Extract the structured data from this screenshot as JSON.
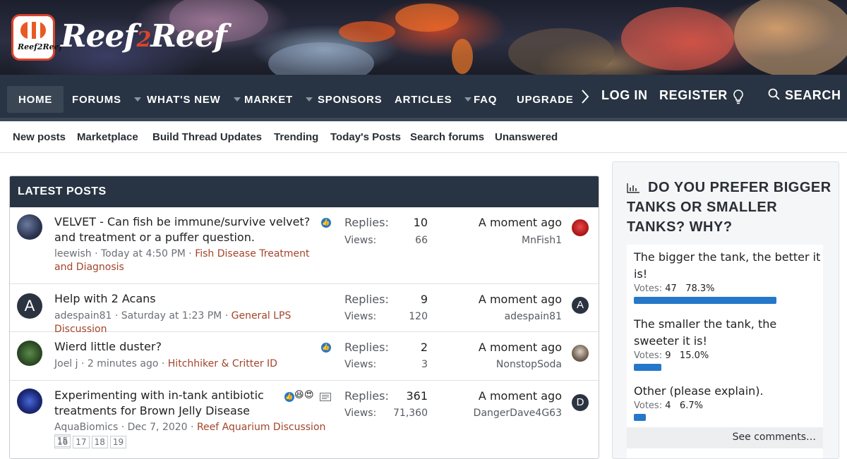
{
  "logo": {
    "badge_text": "Reef2Reef",
    "text_left": "Reef",
    "text_mid": "2",
    "text_right": "Reef"
  },
  "nav": {
    "items": [
      {
        "label": "HOME",
        "active": true
      },
      {
        "label": "FORUMS",
        "caret": true
      },
      {
        "label": "WHAT'S NEW",
        "caret": true
      },
      {
        "label": "MARKET",
        "caret": true
      },
      {
        "label": "SPONSORS"
      },
      {
        "label": "ARTICLES",
        "caret": true
      },
      {
        "label": "FAQ"
      },
      {
        "label": "UPGRADE"
      }
    ],
    "more_icon": "chevron-right-icon",
    "login": "LOG IN",
    "register": "REGISTER",
    "bulb_icon": "lightbulb-icon",
    "search": "SEARCH"
  },
  "subnav": [
    "New posts",
    "Marketplace",
    "Build Thread Updates",
    "Trending",
    "Today's Posts",
    "Search forums",
    "Unanswered"
  ],
  "latest": {
    "header": "LATEST POSTS",
    "replies_label": "Replies:",
    "views_label": "Views:",
    "rows": [
      {
        "title": "VELVET - Can fish be immune/survive velvet? and treatment or a puffer question.",
        "author": "leewish",
        "date": "Today at 4:50 PM",
        "forum": "Fish Disease Treatment and Diagnosis",
        "replies": "10",
        "views": "66",
        "last_time": "A moment ago",
        "last_user": "MnFish1"
      },
      {
        "title": "Help with 2 Acans",
        "author": "adespain81",
        "date": "Saturday at 1:23 PM",
        "forum": "General LPS Discussion",
        "replies": "9",
        "views": "120",
        "last_time": "A moment ago",
        "last_user": "adespain81",
        "avatar_letter": "A",
        "last_letter": "A"
      },
      {
        "title": "Wierd little duster?",
        "author": "Joel j",
        "date": "2 minutes ago",
        "forum": "Hitchhiker & Critter ID",
        "replies": "2",
        "views": "3",
        "last_time": "A moment ago",
        "last_user": "NonstopSoda"
      },
      {
        "title": "Experimenting with in-tank antibiotic treatments for Brown Jelly Disease",
        "author": "AquaBiomics",
        "date": "Dec 7, 2020",
        "forum": "Reef Aquarium Discussion",
        "replies": "361",
        "views": "71,360",
        "last_time": "A moment ago",
        "last_user": "DangerDave4G63",
        "last_letter": "D",
        "pages": [
          "15",
          "16",
          "17",
          "18",
          "19"
        ]
      }
    ]
  },
  "poll": {
    "title": "DO YOU PREFER BIGGER TANKS OR SMALLER TANKS? WHY?",
    "votes_label": "Votes:",
    "options": [
      {
        "text": "The bigger the tank, the better it is!",
        "votes": "47",
        "percent": "78.3%",
        "fraction": 0.783
      },
      {
        "text": "The smaller the tank, the sweeter it is!",
        "votes": "9",
        "percent": "15.0%",
        "fraction": 0.15
      },
      {
        "text": "Other (please explain).",
        "votes": "4",
        "percent": "6.7%",
        "fraction": 0.067
      }
    ],
    "see_comments": "See comments…"
  },
  "colors": {
    "nav_bg": "#283443",
    "accent": "#2577c9",
    "forum_link": "#a3442a",
    "brand_red": "#d8442c"
  }
}
